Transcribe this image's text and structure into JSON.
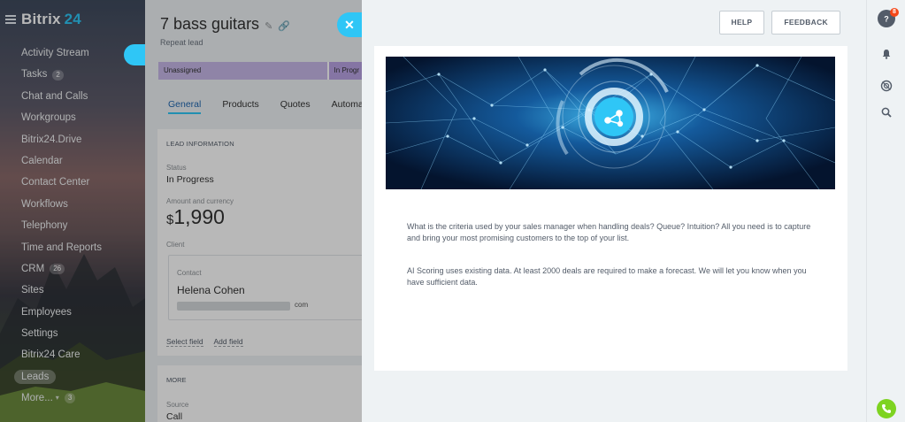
{
  "sidebar": {
    "logo_text": "Bitrix",
    "logo_num": "24",
    "items": [
      {
        "label": "Activity Stream",
        "count": ""
      },
      {
        "label": "Tasks",
        "count": "2"
      },
      {
        "label": "Chat and Calls",
        "count": ""
      },
      {
        "label": "Workgroups",
        "count": ""
      },
      {
        "label": "Bitrix24.Drive",
        "count": ""
      },
      {
        "label": "Calendar",
        "count": ""
      },
      {
        "label": "Contact Center",
        "count": ""
      },
      {
        "label": "Workflows",
        "count": ""
      },
      {
        "label": "Telephony",
        "count": ""
      },
      {
        "label": "Time and Reports",
        "count": ""
      },
      {
        "label": "CRM",
        "count": "26"
      },
      {
        "label": "Sites",
        "count": ""
      },
      {
        "label": "Employees",
        "count": ""
      },
      {
        "label": "Settings",
        "count": ""
      },
      {
        "label": "Bitrix24 Care",
        "count": ""
      },
      {
        "label": "Leads",
        "count": ""
      },
      {
        "label": "More...",
        "count": "3"
      }
    ]
  },
  "crm": {
    "title": "7 bass guitars",
    "subtitle": "Repeat lead",
    "stages": [
      "Unassigned",
      "In Progr"
    ],
    "tabs": [
      "General",
      "Products",
      "Quotes",
      "Automat"
    ],
    "section_title": "LEAD INFORMATION",
    "status_label": "Status",
    "status_value": "In Progress",
    "amount_label": "Amount and currency",
    "amount_currency": "$",
    "amount_value": "1,990",
    "client_label": "Client",
    "contact_label": "Contact",
    "contact_name": "Helena Cohen",
    "contact_email_suffix": "com",
    "select_field": "Select field",
    "add_field": "Add field",
    "more_title": "MORE",
    "source_label": "Source",
    "source_value": "Call"
  },
  "panel": {
    "help_label": "HELP",
    "feedback_label": "FEEDBACK",
    "paragraph1": "What is the criteria used by your sales manager when handling deals? Queue? Intuition? All you need is to capture and bring your most promising customers to the top of your list.",
    "paragraph2": "AI Scoring uses existing data. At least 2000 deals are required to make a forecast. We will let you know when you have sufficient data."
  },
  "rightbar": {
    "help_badge": "8"
  },
  "colors": {
    "accent": "#2fc6f6",
    "phone": "#7ed321",
    "badge": "#f54819"
  }
}
